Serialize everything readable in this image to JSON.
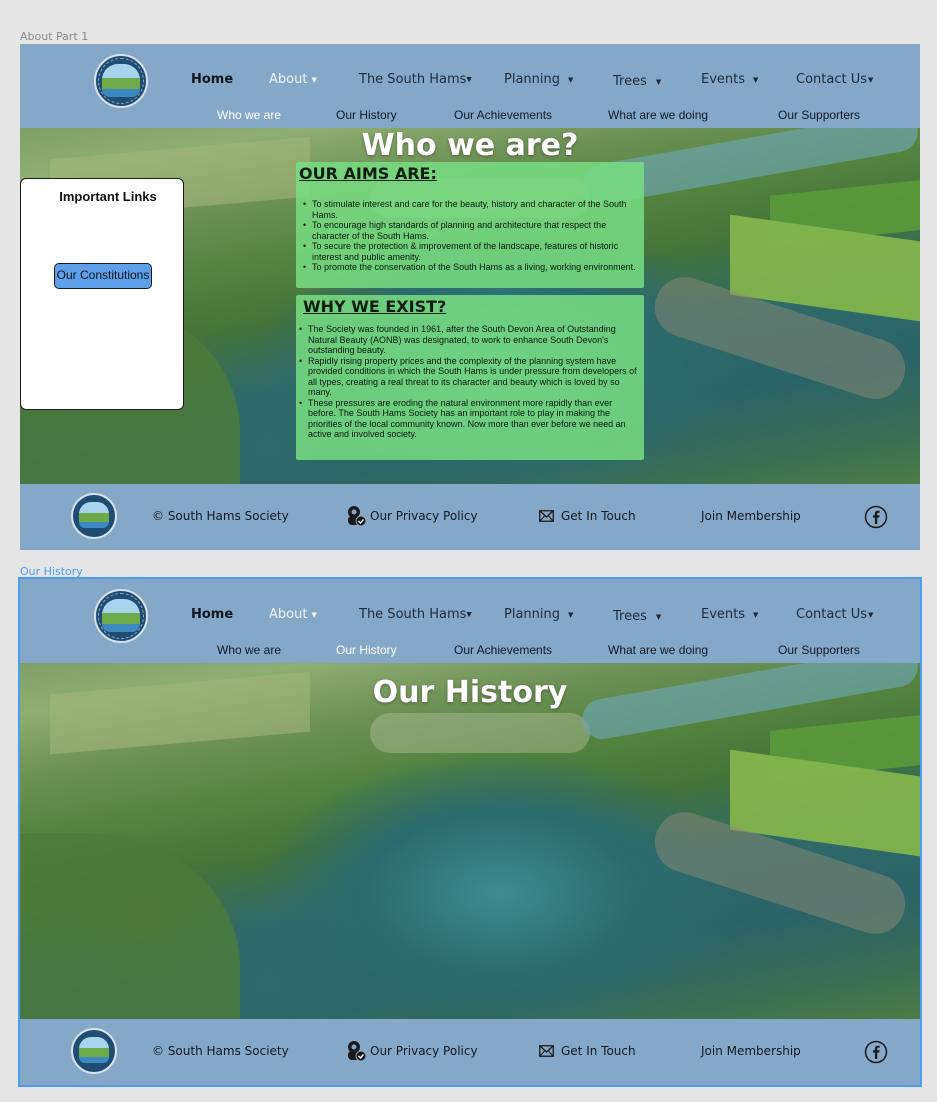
{
  "frames": [
    {
      "label": "About Part 1",
      "hero_title": "Who we are?",
      "links_box": {
        "title": "Important Links",
        "button": "Our Constitutions"
      },
      "aims": {
        "heading": "OUR AIMS ARE:",
        "items": [
          "To stimulate interest and care for the beauty, history and character of the South Hams.",
          "To encourage high standards of planning and architecture that respect the character of the South Hams.",
          "To secure the protection & improvement of the landscape, features of historic interest and public amenity.",
          "To promote the conservation of the South Hams as a living, working environment."
        ]
      },
      "why": {
        "heading": "WHY WE EXIST?",
        "items": [
          "The Society was founded in 1961, after the South Devon Area of Outstanding Natural Beauty (AONB) was designated, to work to enhance South Devon's outstanding beauty.",
          "Rapidly rising property prices and the complexity of the planning system have provided conditions in which the South Hams is under pressure from developers of all types, creating a real threat to its character and beauty which is loved by so many.",
          "These pressures are eroding the natural environment more rapidly than ever before. The South Hams Society has an important role to play in making the priorities of the local community known. Now more than ever before we need an active and involved society."
        ]
      }
    },
    {
      "label": "Our History",
      "hero_title": "Our History"
    }
  ],
  "nav": {
    "main": [
      "Home",
      "About",
      "The South Hams",
      "Planning",
      "Trees",
      "Events",
      "Contact Us"
    ],
    "sub": [
      "Who we are",
      "Our History",
      "Our Achievements",
      "What are we doing",
      "Our Supporters"
    ]
  },
  "footer": {
    "copyright": "© South Hams Society",
    "privacy": "Our Privacy Policy",
    "contact": "Get In Touch",
    "membership": "Join Membership"
  },
  "icons": {
    "privacy": "privacy-shield-icon",
    "contact": "envelope-icon",
    "social": "facebook-icon"
  },
  "colors": {
    "header_bg": "#86a8c8",
    "panel_green": "#78de82",
    "button_blue": "#5e9fea",
    "selection_blue": "#4a9cf0"
  }
}
